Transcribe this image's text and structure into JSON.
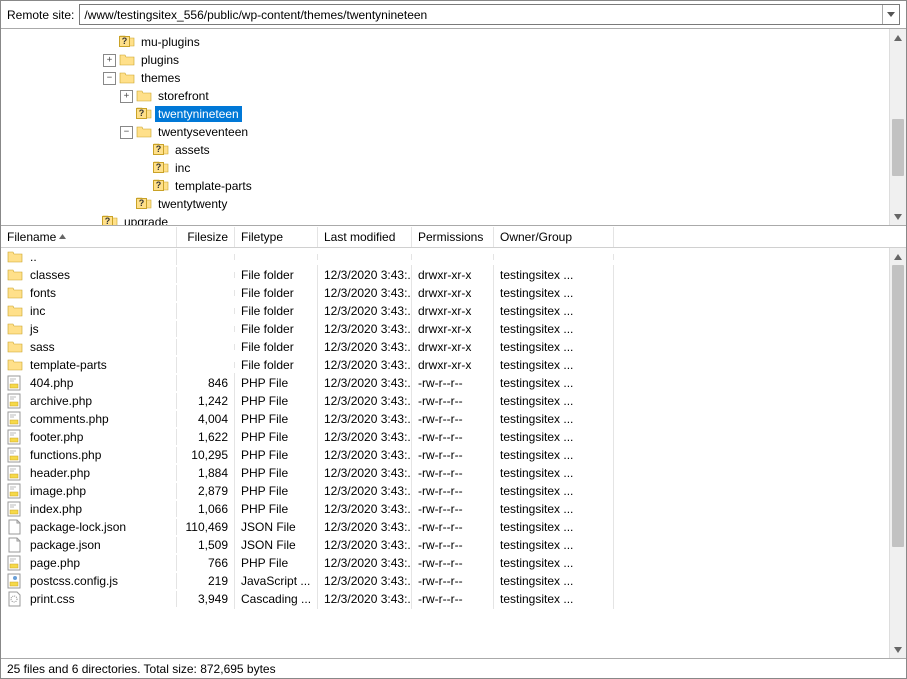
{
  "topbar": {
    "label": "Remote site:",
    "path": "/www/testingsitex_556/public/wp-content/themes/twentynineteen"
  },
  "tree": [
    {
      "indent": 6,
      "toggle": "",
      "icon": "folder-q",
      "label": "mu-plugins"
    },
    {
      "indent": 6,
      "toggle": "+",
      "icon": "folder",
      "label": "plugins"
    },
    {
      "indent": 6,
      "toggle": "-",
      "icon": "folder",
      "label": "themes"
    },
    {
      "indent": 7,
      "toggle": "+",
      "icon": "folder",
      "label": "storefront"
    },
    {
      "indent": 7,
      "toggle": "",
      "icon": "folder-q",
      "label": "twentynineteen",
      "selected": true
    },
    {
      "indent": 7,
      "toggle": "-",
      "icon": "folder",
      "label": "twentyseventeen"
    },
    {
      "indent": 8,
      "toggle": "",
      "icon": "folder-q",
      "label": "assets"
    },
    {
      "indent": 8,
      "toggle": "",
      "icon": "folder-q",
      "label": "inc"
    },
    {
      "indent": 8,
      "toggle": "",
      "icon": "folder-q",
      "label": "template-parts"
    },
    {
      "indent": 7,
      "toggle": "",
      "icon": "folder-q",
      "label": "twentytwenty"
    },
    {
      "indent": 5,
      "toggle": "",
      "icon": "folder-q",
      "label": "upgrade"
    }
  ],
  "columns": {
    "name": "Filename",
    "size": "Filesize",
    "type": "Filetype",
    "modified": "Last modified",
    "permissions": "Permissions",
    "owner": "Owner/Group"
  },
  "files": [
    {
      "icon": "folder",
      "name": "..",
      "size": "",
      "type": "",
      "modified": "",
      "perm": "",
      "owner": ""
    },
    {
      "icon": "folder",
      "name": "classes",
      "size": "",
      "type": "File folder",
      "modified": "12/3/2020 3:43:...",
      "perm": "drwxr-xr-x",
      "owner": "testingsitex ..."
    },
    {
      "icon": "folder",
      "name": "fonts",
      "size": "",
      "type": "File folder",
      "modified": "12/3/2020 3:43:...",
      "perm": "drwxr-xr-x",
      "owner": "testingsitex ..."
    },
    {
      "icon": "folder",
      "name": "inc",
      "size": "",
      "type": "File folder",
      "modified": "12/3/2020 3:43:...",
      "perm": "drwxr-xr-x",
      "owner": "testingsitex ..."
    },
    {
      "icon": "folder",
      "name": "js",
      "size": "",
      "type": "File folder",
      "modified": "12/3/2020 3:43:...",
      "perm": "drwxr-xr-x",
      "owner": "testingsitex ..."
    },
    {
      "icon": "folder",
      "name": "sass",
      "size": "",
      "type": "File folder",
      "modified": "12/3/2020 3:43:...",
      "perm": "drwxr-xr-x",
      "owner": "testingsitex ..."
    },
    {
      "icon": "folder",
      "name": "template-parts",
      "size": "",
      "type": "File folder",
      "modified": "12/3/2020 3:43:...",
      "perm": "drwxr-xr-x",
      "owner": "testingsitex ..."
    },
    {
      "icon": "php",
      "name": "404.php",
      "size": "846",
      "type": "PHP File",
      "modified": "12/3/2020 3:43:...",
      "perm": "-rw-r--r--",
      "owner": "testingsitex ..."
    },
    {
      "icon": "php",
      "name": "archive.php",
      "size": "1,242",
      "type": "PHP File",
      "modified": "12/3/2020 3:43:...",
      "perm": "-rw-r--r--",
      "owner": "testingsitex ..."
    },
    {
      "icon": "php",
      "name": "comments.php",
      "size": "4,004",
      "type": "PHP File",
      "modified": "12/3/2020 3:43:...",
      "perm": "-rw-r--r--",
      "owner": "testingsitex ..."
    },
    {
      "icon": "php",
      "name": "footer.php",
      "size": "1,622",
      "type": "PHP File",
      "modified": "12/3/2020 3:43:...",
      "perm": "-rw-r--r--",
      "owner": "testingsitex ..."
    },
    {
      "icon": "php",
      "name": "functions.php",
      "size": "10,295",
      "type": "PHP File",
      "modified": "12/3/2020 3:43:...",
      "perm": "-rw-r--r--",
      "owner": "testingsitex ..."
    },
    {
      "icon": "php",
      "name": "header.php",
      "size": "1,884",
      "type": "PHP File",
      "modified": "12/3/2020 3:43:...",
      "perm": "-rw-r--r--",
      "owner": "testingsitex ..."
    },
    {
      "icon": "php",
      "name": "image.php",
      "size": "2,879",
      "type": "PHP File",
      "modified": "12/3/2020 3:43:...",
      "perm": "-rw-r--r--",
      "owner": "testingsitex ..."
    },
    {
      "icon": "php",
      "name": "index.php",
      "size": "1,066",
      "type": "PHP File",
      "modified": "12/3/2020 3:43:...",
      "perm": "-rw-r--r--",
      "owner": "testingsitex ..."
    },
    {
      "icon": "json",
      "name": "package-lock.json",
      "size": "110,469",
      "type": "JSON File",
      "modified": "12/3/2020 3:43:...",
      "perm": "-rw-r--r--",
      "owner": "testingsitex ..."
    },
    {
      "icon": "json",
      "name": "package.json",
      "size": "1,509",
      "type": "JSON File",
      "modified": "12/3/2020 3:43:...",
      "perm": "-rw-r--r--",
      "owner": "testingsitex ..."
    },
    {
      "icon": "php",
      "name": "page.php",
      "size": "766",
      "type": "PHP File",
      "modified": "12/3/2020 3:43:...",
      "perm": "-rw-r--r--",
      "owner": "testingsitex ..."
    },
    {
      "icon": "js",
      "name": "postcss.config.js",
      "size": "219",
      "type": "JavaScript ...",
      "modified": "12/3/2020 3:43:...",
      "perm": "-rw-r--r--",
      "owner": "testingsitex ..."
    },
    {
      "icon": "css",
      "name": "print.css",
      "size": "3,949",
      "type": "Cascading ...",
      "modified": "12/3/2020 3:43:...",
      "perm": "-rw-r--r--",
      "owner": "testingsitex ..."
    }
  ],
  "status": "25 files and 6 directories. Total size: 872,695 bytes"
}
